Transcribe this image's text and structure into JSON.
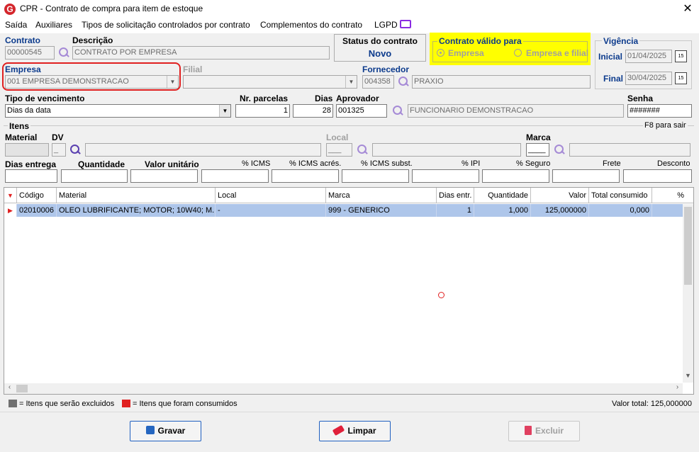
{
  "window": {
    "title": "CPR - Contrato de compra para item de estoque",
    "close": "✕"
  },
  "menu": [
    "Saída",
    "Auxiliares",
    "Tipos de solicitação controlados por contrato",
    "Complementos do contrato",
    "LGPD"
  ],
  "contrato": {
    "label": "Contrato",
    "value": "00000545"
  },
  "descricao": {
    "label": "Descrição",
    "value": "CONTRATO POR EMPRESA"
  },
  "status": {
    "label": "Status do contrato",
    "value": "Novo"
  },
  "contrato_valido": {
    "label": "Contrato válido para",
    "opt1": "Empresa",
    "opt2": "Empresa e filial",
    "selected": "Empresa"
  },
  "vigencia": {
    "label": "Vigência",
    "inicial_label": "Inicial",
    "inicial": "01/04/2025",
    "final_label": "Final",
    "final": "30/04/2025",
    "cal": "15"
  },
  "empresa": {
    "label": "Empresa",
    "value": "001 EMPRESA DEMONSTRACAO"
  },
  "filial": {
    "label": "Filial",
    "value": ""
  },
  "fornecedor": {
    "label": "Fornecedor",
    "code": "004358",
    "name": "PRAXIO"
  },
  "tipo_venc": {
    "label": "Tipo de vencimento",
    "value": "Dias da data"
  },
  "nr_parcelas": {
    "label": "Nr. parcelas",
    "value": "1"
  },
  "dias": {
    "label": "Dias",
    "value": "28"
  },
  "aprovador": {
    "label": "Aprovador",
    "code": "001325",
    "name": "FUNCIONARIO DEMONSTRACAO"
  },
  "senha": {
    "label": "Senha",
    "value": "#######"
  },
  "itens": {
    "label": "Itens",
    "hint": "F8 para sair"
  },
  "material": {
    "label": "Material",
    "dv_label": "DV",
    "dv_value": "_",
    "local_label": "Local",
    "local_value": "___",
    "marca_label": "Marca",
    "marca_value": "____"
  },
  "row2labels": {
    "dias_entrega": "Dias entrega",
    "quantidade": "Quantidade",
    "valor_unitario": "Valor unitário",
    "icms": "% ICMS",
    "icms_acres": "% ICMS acrés.",
    "icms_subst": "% ICMS subst.",
    "ipi": "% IPI",
    "seguro": "% Seguro",
    "frete": "Frete",
    "desconto": "Desconto"
  },
  "grid": {
    "headers": [
      "Código",
      "Material",
      "Local",
      "Marca",
      "Dias entr.",
      "Quantidade",
      "Valor",
      "Total consumido",
      "%"
    ],
    "rows": [
      [
        "02010006",
        "OLEO LUBRIFICANTE; MOTOR; 10W40; M...",
        "-",
        "999 - GENERICO",
        "1",
        "1,000",
        "125,000000",
        "0,000",
        ""
      ]
    ]
  },
  "legend": {
    "gray": "= Itens que serão excluidos",
    "red": "= Itens que foram consumidos",
    "total": "Valor total: 125,000000"
  },
  "buttons": {
    "gravar": "Gravar",
    "limpar": "Limpar",
    "excluir": "Excluir"
  },
  "colors": {
    "accent": "#0b3a8c",
    "highlight": "#ffff00",
    "selection": "#aec6ea",
    "red": "#e02020"
  }
}
